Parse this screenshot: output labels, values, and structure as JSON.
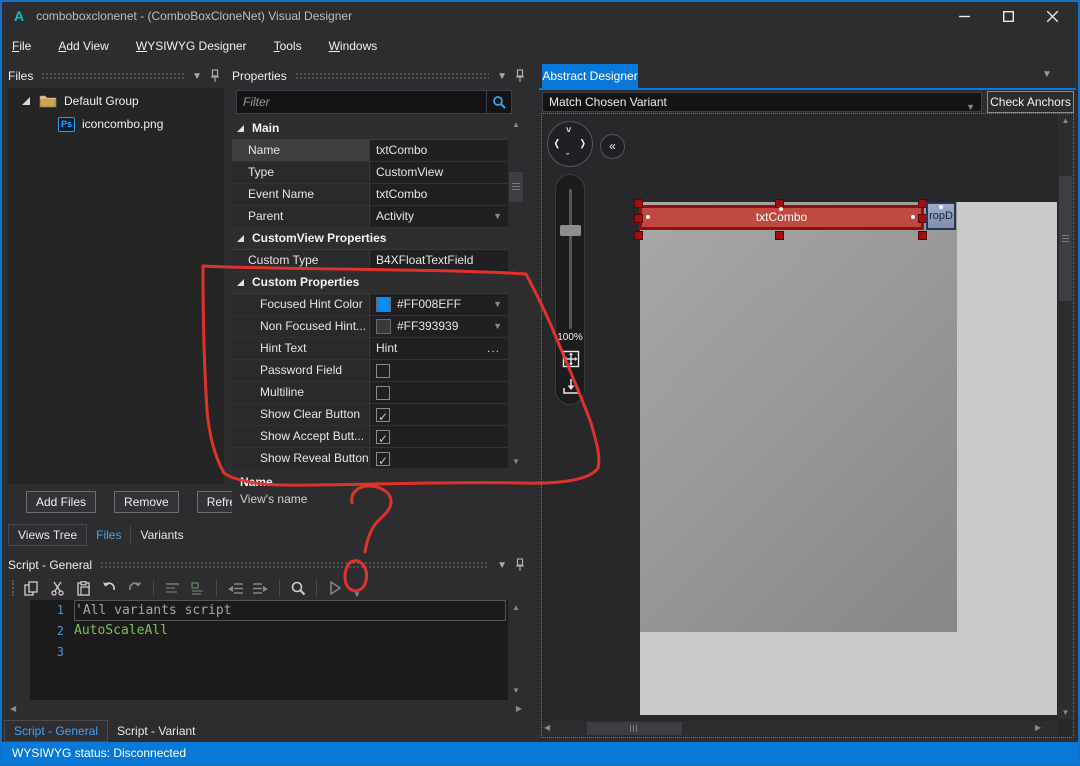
{
  "window": {
    "logo": "A",
    "title": "comboboxclonenet - (ComboBoxCloneNet) Visual Designer"
  },
  "menu": {
    "items": [
      {
        "label": "File"
      },
      {
        "label": "Add View"
      },
      {
        "label": "WYSIWYG Designer"
      },
      {
        "label": "Tools"
      },
      {
        "label": "Windows"
      }
    ]
  },
  "files_panel": {
    "title": "Files",
    "group_label": "Default Group",
    "file_label": "iconcombo.png",
    "file_badge": "Ps",
    "buttons": {
      "add": "Add Files",
      "remove": "Remove",
      "refresh": "Refresh"
    },
    "tabs": {
      "views_tree": "Views Tree",
      "files": "Files",
      "variants": "Variants"
    }
  },
  "properties_panel": {
    "title": "Properties",
    "filter_placeholder": "Filter",
    "groups": [
      {
        "name": "Main",
        "rows": [
          {
            "label": "Name",
            "value": "txtCombo",
            "selected": true
          },
          {
            "label": "Type",
            "value": "CustomView"
          },
          {
            "label": "Event Name",
            "value": "txtCombo"
          },
          {
            "label": "Parent",
            "value": "Activity",
            "dropdown": true
          }
        ]
      },
      {
        "name": "CustomView Properties",
        "rows": [
          {
            "label": "Custom Type",
            "value": "B4XFloatTextField"
          }
        ]
      },
      {
        "name": "Custom Properties",
        "rows": [
          {
            "label": "Focused Hint Color",
            "value": "#FF008EFF",
            "swatch": "#008EFF",
            "dropdown": true
          },
          {
            "label": "Non Focused Hint...",
            "value": "#FF393939",
            "swatch": "#393939",
            "dropdown": true
          },
          {
            "label": "Hint Text",
            "value": "Hint",
            "ellipsis": "..."
          },
          {
            "label": "Password Field",
            "checked": false
          },
          {
            "label": "Multiline",
            "checked": false
          },
          {
            "label": "Show Clear Button",
            "checked": true
          },
          {
            "label": "Show Accept Butt...",
            "checked": true
          },
          {
            "label": "Show Reveal Button",
            "checked": true
          }
        ]
      }
    ],
    "description": {
      "title": "Name",
      "text": "View's name"
    }
  },
  "script_panel": {
    "title": "Script - General",
    "toolbar_icons": [
      "copy",
      "cut",
      "paste",
      "undo",
      "redo",
      "comment",
      "uncomment",
      "shift-left",
      "shift-right",
      "find",
      "run"
    ],
    "code": [
      {
        "num": "1",
        "text": "'All variants script"
      },
      {
        "num": "2",
        "text": "AutoScaleAll"
      },
      {
        "num": "3",
        "text": ""
      }
    ],
    "tabs": {
      "general": "Script - General",
      "variant": "Script - Variant"
    }
  },
  "designer": {
    "tab": "Abstract Designer",
    "variant_combo": "Match Chosen Variant",
    "check_anchors": "Check Anchors",
    "zoom": "100%",
    "collapse_glyph": "«",
    "view_label": "txtCombo",
    "dropdown_button": "ropD"
  },
  "status_bar": {
    "text": "WYSIWYG status: Disconnected"
  },
  "colors": {
    "accent_blue": "#0879D9",
    "selection_red": "#C04A42",
    "selection_border": "#8F100C",
    "annotation_red": "#E8342C",
    "focused_hint_swatch": "#008EFF",
    "non_focused_hint_swatch": "#393939"
  }
}
